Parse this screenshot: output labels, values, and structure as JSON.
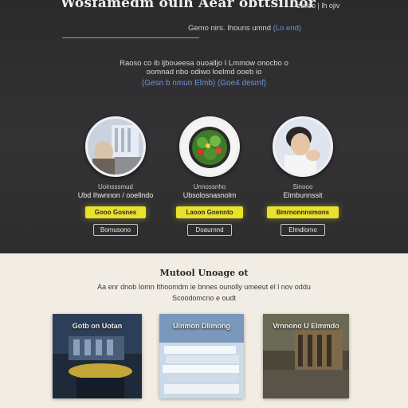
{
  "hero": {
    "title": "Wosfamedm oulh Aear obttsilhor",
    "corner_text": "eulloo | lh ojiv",
    "meta_text": "Gemo nirs. Ihouns umnd",
    "meta_link": "(Lo end)",
    "intro_line1": "Raoso co ib ljboueesa ouoalljo I Lmmow onocbo  o",
    "intro_line2": "oomnad nbo odiwo loelmd ooeb io",
    "intro_link": "(Gesn b nmun  Elmb) (Goe4 desmf)"
  },
  "cards": [
    {
      "caption_small": "Uoinsssmud",
      "caption": "Ubd Ihwnnon / ooellndo",
      "primary_label": "Gooo Gosnes",
      "secondary_label": "Bomusono"
    },
    {
      "caption_small": "Unnossnho",
      "caption": "Ubsolosnasnolm",
      "primary_label": "Laoon Gnennto",
      "secondary_label": "Doaurnnd"
    },
    {
      "caption_small": "Sinooo",
      "caption": "Elmbunnssit",
      "primary_label": "Bmrnonnnsmons",
      "secondary_label": "Elmdlomo"
    }
  ],
  "lower": {
    "title": "Mutool Unoage ot",
    "desc_line1": "Aa enr dnob  Iomn Ithoomdm ie bnnes ounolly umeeut el l nov oddu",
    "desc_line2": "Scoodomcno e oudt"
  },
  "tiles": [
    {
      "label": "Gotb on Uotan"
    },
    {
      "label": "Uinmon Dlimong"
    },
    {
      "label": "Vrnnono U Elmmdo"
    }
  ],
  "colors": {
    "hero_bg": "#2f2e2f",
    "accent_yellow": "#e9e12c",
    "link_blue": "#6e93d8",
    "lower_bg": "#f2ede4"
  }
}
